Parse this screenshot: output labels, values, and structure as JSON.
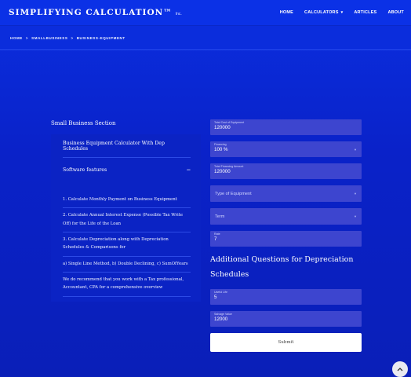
{
  "brand": {
    "name": "SIMPLIFYING CALCULATION™",
    "suffix": "Inc."
  },
  "nav": {
    "home": "HOME",
    "calculators": "CALCULATORS",
    "articles": "ARTICLES",
    "about": "ABOUT"
  },
  "breadcrumb": {
    "home": "Home",
    "category": "Smallbusiness",
    "page": "Business-equipment",
    "separator": ">"
  },
  "section": {
    "title": "Small Business Section",
    "accordion": {
      "item1": "Business Equipment Calculator With Dep Schedules",
      "item2": "Software features",
      "toggle": "−",
      "features": [
        "1. Calculate Monthly Payment on Business Equipment",
        "2. Calculate Annual Interest Expense (Possible Tax Write Off) for the Life of the Loan",
        "3. Calculate Depreciation along with Depreciation Schedules & Comparisons for",
        "a) Single Line Method, b) Double Declining, c) SumOfYears",
        "We do recommend that you work with a Tax professional, Accountant, CPA for a comprehensive overview"
      ]
    }
  },
  "form": {
    "total_cost": {
      "label": "Total Cost of Equipment",
      "value": "120000"
    },
    "financing": {
      "label": "Financing",
      "value": "100 %"
    },
    "total_financing": {
      "label": "Total Financing Amount",
      "value": "120000"
    },
    "type_of_equipment": {
      "placeholder": "Type of Equipment"
    },
    "term": {
      "placeholder": "Term"
    },
    "rate": {
      "label": "Rate",
      "value": "7"
    },
    "questions_title": "Additional Questions for Depreciation Schedules",
    "useful_life": {
      "label": "Useful Life",
      "value": "5"
    },
    "salvage_value": {
      "label": "Salvage Value",
      "value": "12000"
    },
    "submit_label": "Submit"
  },
  "colors": {
    "background": "#0b2fe0",
    "field": "#3d45cf",
    "panel": "#0b23c4",
    "button": "#ffffff"
  },
  "icons": {
    "dropdown": "chevron-down-icon",
    "collapse": "minus-icon",
    "scroll_top": "chevron-up-icon"
  }
}
